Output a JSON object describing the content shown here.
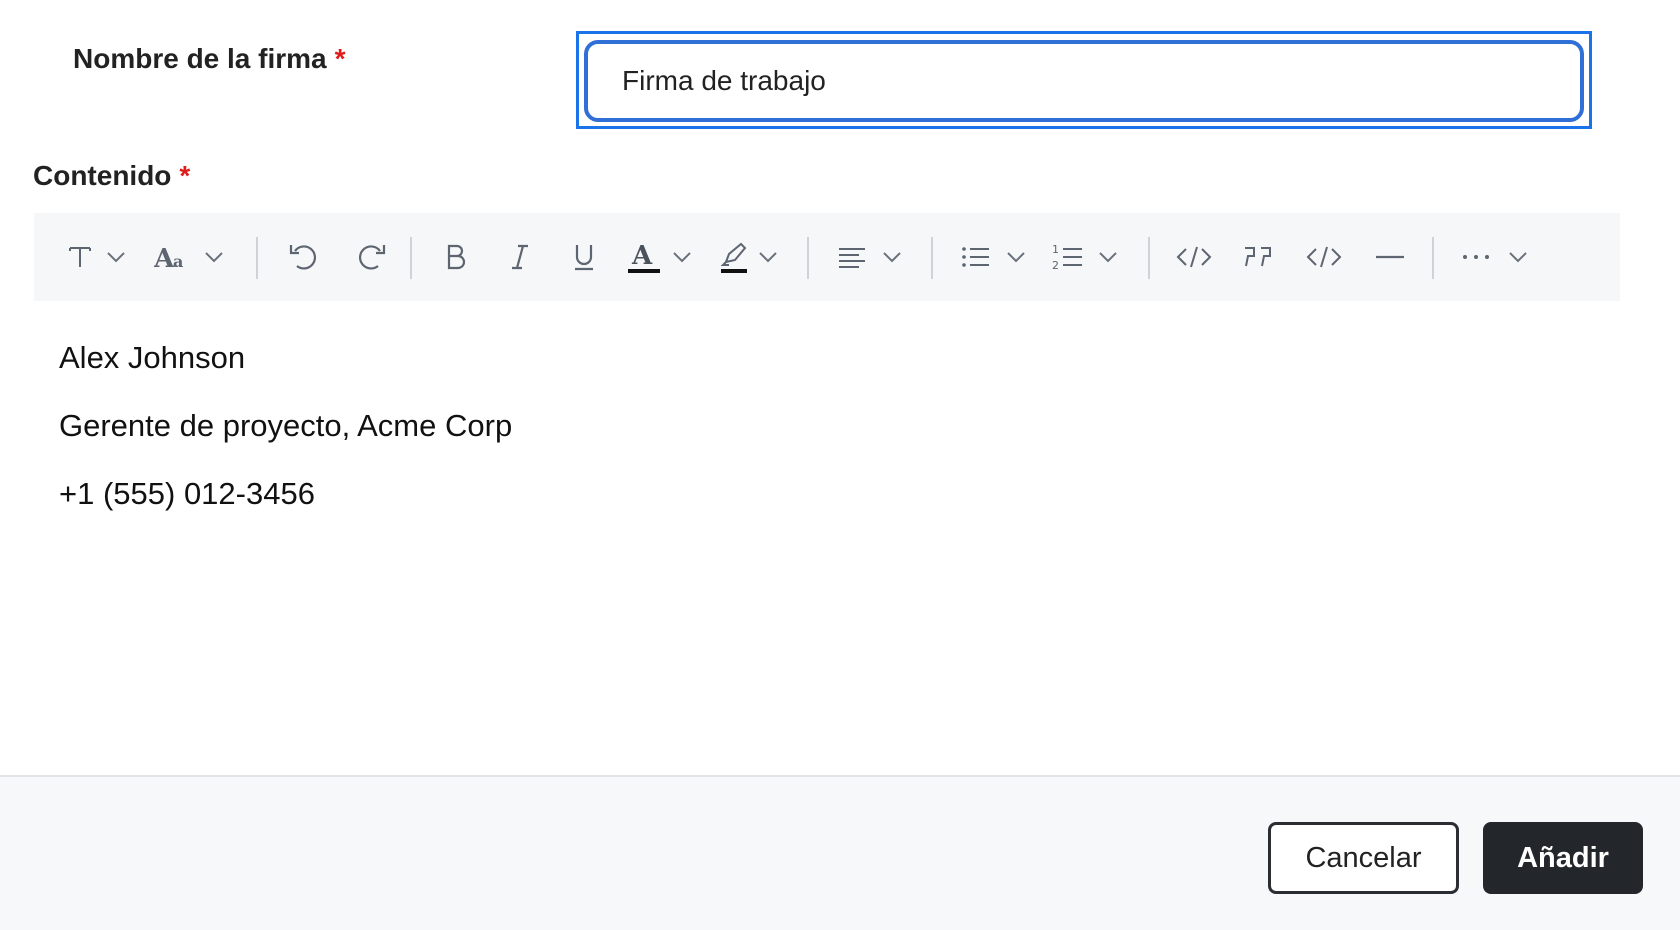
{
  "form": {
    "name_label": "Nombre de la firma",
    "name_required": "*",
    "name_value": "Firma de trabajo",
    "content_label": "Contenido",
    "content_required": "*"
  },
  "toolbar": {
    "icons": [
      "text-style-icon",
      "font-size-icon",
      "undo-icon",
      "redo-icon",
      "bold-icon",
      "italic-icon",
      "underline-icon",
      "font-color-icon",
      "highlight-icon",
      "align-icon",
      "bullet-list-icon",
      "numbered-list-icon",
      "code-icon",
      "quote-icon",
      "code-block-icon",
      "horizontal-rule-icon",
      "more-icon"
    ]
  },
  "editor": {
    "lines": [
      "Alex Johnson",
      "Gerente de proyecto, Acme Corp",
      "+1 (555) 012-3456"
    ]
  },
  "footer": {
    "cancel_label": "Cancelar",
    "add_label": "Añadir"
  },
  "colors": {
    "focus": "#1a73e8",
    "required": "#e01b1b",
    "primary_button": "#23262b"
  }
}
